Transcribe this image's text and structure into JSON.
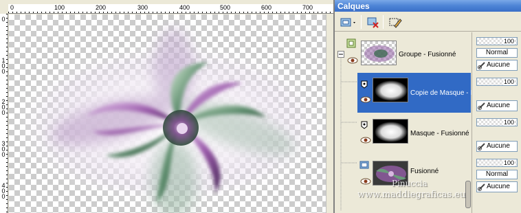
{
  "ruler": {
    "top_labels": [
      "0",
      "100",
      "200",
      "300",
      "400",
      "500",
      "600",
      "700"
    ],
    "left_labels": [
      "0",
      "1\n0\n0",
      "2\n0\n0",
      "3\n0\n0",
      "4\n0\n0"
    ]
  },
  "panel": {
    "title": "Calques"
  },
  "layers": [
    {
      "name": "Groupe - Fusionné",
      "type": "group",
      "selected": false
    },
    {
      "name": "Copie de Masque - F",
      "type": "mask",
      "selected": true
    },
    {
      "name": "Masque - Fusionné",
      "type": "mask",
      "selected": false
    },
    {
      "name": "Fusionné",
      "type": "raster",
      "selected": false
    }
  ],
  "props": [
    {
      "opacity": "100",
      "blend": "Normal",
      "mask_link": "Aucune"
    },
    {
      "opacity": "100",
      "blend": "",
      "mask_link": "Aucune"
    },
    {
      "opacity": "100",
      "blend": "",
      "mask_link": "Aucune"
    },
    {
      "opacity": "100",
      "blend": "Normal",
      "mask_link": "Aucune"
    }
  ],
  "watermark": {
    "line1": "Pinuccia",
    "line2": "www.maddiegraficas.eu"
  },
  "colors": {
    "selected": "#316ac5",
    "titlebar": "#4d84d6",
    "purple": "#8a4a9a",
    "green": "#3e6b52"
  },
  "icons": [
    "layer-new-icon",
    "layer-delete-icon",
    "layer-properties-icon",
    "eye-icon",
    "mask-icon",
    "chain-icon",
    "collapse-icon"
  ]
}
